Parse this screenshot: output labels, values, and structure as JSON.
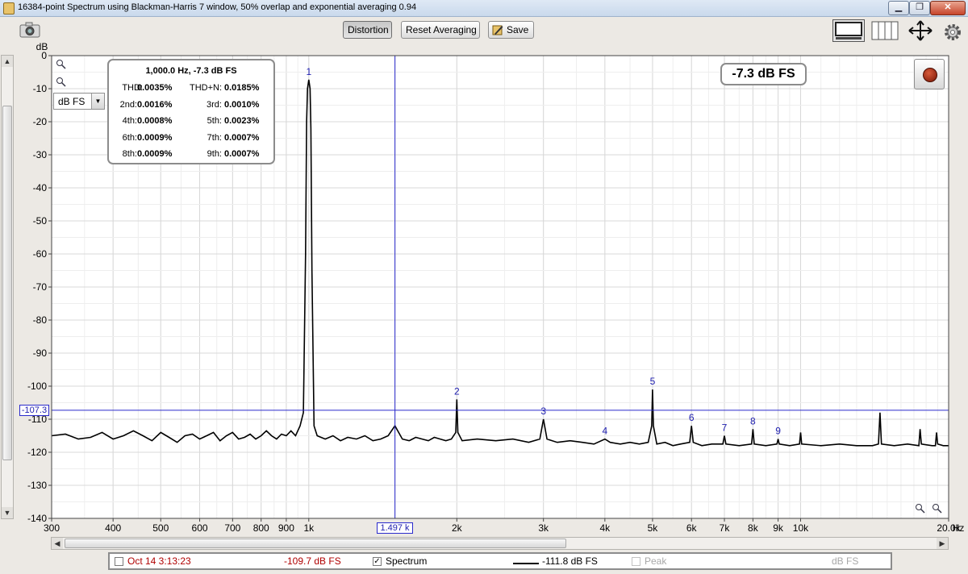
{
  "window": {
    "title": "16384-point Spectrum using Blackman-Harris 7 window, 50% overlap and exponential averaging 0.94",
    "min_label": "▁",
    "restore_label": "❐",
    "close_label": "✕"
  },
  "toolbar": {
    "distortion_label": "Distortion",
    "reset_averaging_label": "Reset Averaging",
    "save_label": "Save"
  },
  "icons": {
    "camera": "camera-icon",
    "save": "pencil-disk-icon",
    "layout": "layout-icon",
    "columns": "columns-icon",
    "pan": "move-arrows-icon",
    "settings": "gear-icon",
    "zoom": "magnifier-icon"
  },
  "plot": {
    "y_unit_label": "dB",
    "units_select_value": "dB FS",
    "x_unit_label": "Hz",
    "level_readout": "-7.3 dB FS",
    "y_cursor_label": "-107.3",
    "x_cursor_label": "1.497 k"
  },
  "distortion": {
    "header": "1,000.0 Hz, -7.3 dB FS",
    "rows": [
      {
        "l1": "THD:",
        "v1": "0.0035%",
        "l2": "THD+N:",
        "v2": "0.0185%"
      },
      {
        "l1": "2nd:",
        "v1": "0.0016%",
        "l2": "3rd:",
        "v2": "0.0010%"
      },
      {
        "l1": "4th:",
        "v1": "0.0008%",
        "l2": "5th:",
        "v2": "0.0023%"
      },
      {
        "l1": "6th:",
        "v1": "0.0009%",
        "l2": "7th:",
        "v2": "0.0007%"
      },
      {
        "l1": "8th:",
        "v1": "0.0009%",
        "l2": "9th:",
        "v2": "0.0007%"
      }
    ]
  },
  "legend": {
    "capture_label": "Oct 14 3:13:23",
    "capture_value": "-109.7 dB FS",
    "spectrum_label": "Spectrum",
    "spectrum_value": "-111.8 dB FS",
    "peak_label": "Peak",
    "peak_value": "dB FS",
    "capture_color": "#b00000",
    "spectrum_checked": "✓"
  },
  "colors": {
    "trace": "#000000",
    "cursor": "#2a2acc",
    "grid": "#d8d8d8",
    "marker_text": "#2020b0"
  },
  "chart_data": {
    "type": "line",
    "x_scale": "log",
    "xlim": [
      300,
      20000
    ],
    "ylim": [
      -140,
      0
    ],
    "xlabel": "Hz",
    "ylabel": "dB",
    "x_ticks": [
      {
        "v": 300,
        "label": "300"
      },
      {
        "v": 400,
        "label": "400"
      },
      {
        "v": 500,
        "label": "500"
      },
      {
        "v": 600,
        "label": "600"
      },
      {
        "v": 700,
        "label": "700"
      },
      {
        "v": 800,
        "label": "800"
      },
      {
        "v": 900,
        "label": "900"
      },
      {
        "v": 1000,
        "label": "1k"
      },
      {
        "v": 2000,
        "label": "2k"
      },
      {
        "v": 3000,
        "label": "3k"
      },
      {
        "v": 4000,
        "label": "4k"
      },
      {
        "v": 5000,
        "label": "5k"
      },
      {
        "v": 6000,
        "label": "6k"
      },
      {
        "v": 7000,
        "label": "7k"
      },
      {
        "v": 8000,
        "label": "8k"
      },
      {
        "v": 9000,
        "label": "9k"
      },
      {
        "v": 10000,
        "label": "10k"
      },
      {
        "v": 20000,
        "label": "20.0k"
      }
    ],
    "y_ticks": [
      {
        "v": 0,
        "label": "0"
      },
      {
        "v": -10,
        "label": "-10"
      },
      {
        "v": -20,
        "label": "-20"
      },
      {
        "v": -30,
        "label": "-30"
      },
      {
        "v": -40,
        "label": "-40"
      },
      {
        "v": -50,
        "label": "-50"
      },
      {
        "v": -60,
        "label": "-60"
      },
      {
        "v": -70,
        "label": "-70"
      },
      {
        "v": -80,
        "label": "-80"
      },
      {
        "v": -90,
        "label": "-90"
      },
      {
        "v": -100,
        "label": "-100"
      },
      {
        "v": -110,
        "label": "-110"
      },
      {
        "v": -120,
        "label": "-120"
      },
      {
        "v": -130,
        "label": "-130"
      },
      {
        "v": -140,
        "label": "-140"
      }
    ],
    "cursor": {
      "x": 1497,
      "y": -107.3
    },
    "harmonics": [
      {
        "label": "1",
        "f": 1000,
        "db": -7.3
      },
      {
        "label": "2",
        "f": 2000,
        "db": -104
      },
      {
        "label": "3",
        "f": 3000,
        "db": -110
      },
      {
        "label": "4",
        "f": 4000,
        "db": -116
      },
      {
        "label": "5",
        "f": 5000,
        "db": -101
      },
      {
        "label": "6",
        "f": 6000,
        "db": -112
      },
      {
        "label": "7",
        "f": 7000,
        "db": -115
      },
      {
        "label": "8",
        "f": 8000,
        "db": -113
      },
      {
        "label": "9",
        "f": 9000,
        "db": -116
      }
    ],
    "series": [
      {
        "values_note": "",
        "points": [
          [
            300,
            -115
          ],
          [
            320,
            -114.5
          ],
          [
            340,
            -116
          ],
          [
            360,
            -115.5
          ],
          [
            380,
            -114
          ],
          [
            400,
            -116
          ],
          [
            420,
            -115
          ],
          [
            440,
            -113.5
          ],
          [
            460,
            -115
          ],
          [
            480,
            -116.5
          ],
          [
            500,
            -114
          ],
          [
            520,
            -115.5
          ],
          [
            540,
            -117
          ],
          [
            560,
            -115
          ],
          [
            580,
            -114.5
          ],
          [
            600,
            -116
          ],
          [
            620,
            -115
          ],
          [
            640,
            -114
          ],
          [
            660,
            -116.5
          ],
          [
            680,
            -115
          ],
          [
            700,
            -114
          ],
          [
            720,
            -116
          ],
          [
            740,
            -115.5
          ],
          [
            760,
            -114.5
          ],
          [
            780,
            -116
          ],
          [
            800,
            -115
          ],
          [
            820,
            -113.5
          ],
          [
            840,
            -115
          ],
          [
            860,
            -116
          ],
          [
            880,
            -114.5
          ],
          [
            900,
            -115
          ],
          [
            920,
            -113.5
          ],
          [
            940,
            -115
          ],
          [
            960,
            -112
          ],
          [
            975,
            -108
          ],
          [
            985,
            -60
          ],
          [
            990,
            -20
          ],
          [
            994,
            -10
          ],
          [
            1000,
            -7.3
          ],
          [
            1006,
            -10
          ],
          [
            1010,
            -22
          ],
          [
            1015,
            -65
          ],
          [
            1025,
            -112
          ],
          [
            1040,
            -115
          ],
          [
            1080,
            -116
          ],
          [
            1120,
            -115
          ],
          [
            1160,
            -116.5
          ],
          [
            1200,
            -115.5
          ],
          [
            1250,
            -116
          ],
          [
            1300,
            -115
          ],
          [
            1350,
            -116.5
          ],
          [
            1400,
            -116
          ],
          [
            1450,
            -115
          ],
          [
            1497,
            -112
          ],
          [
            1550,
            -116
          ],
          [
            1600,
            -116.5
          ],
          [
            1650,
            -115.5
          ],
          [
            1700,
            -116
          ],
          [
            1750,
            -116.5
          ],
          [
            1800,
            -115.5
          ],
          [
            1850,
            -116
          ],
          [
            1900,
            -116.5
          ],
          [
            1950,
            -116
          ],
          [
            1990,
            -114
          ],
          [
            2000,
            -104
          ],
          [
            2010,
            -114
          ],
          [
            2050,
            -116.5
          ],
          [
            2200,
            -116
          ],
          [
            2400,
            -116.5
          ],
          [
            2600,
            -116
          ],
          [
            2800,
            -117
          ],
          [
            2950,
            -116
          ],
          [
            3000,
            -110
          ],
          [
            3050,
            -116
          ],
          [
            3200,
            -117
          ],
          [
            3400,
            -116.5
          ],
          [
            3600,
            -117
          ],
          [
            3800,
            -117.5
          ],
          [
            4000,
            -116
          ],
          [
            4100,
            -117
          ],
          [
            4300,
            -117.5
          ],
          [
            4500,
            -117
          ],
          [
            4700,
            -117.5
          ],
          [
            4900,
            -117
          ],
          [
            4980,
            -112
          ],
          [
            5000,
            -101
          ],
          [
            5020,
            -112
          ],
          [
            5100,
            -117.5
          ],
          [
            5300,
            -117
          ],
          [
            5500,
            -118
          ],
          [
            5700,
            -117.5
          ],
          [
            5950,
            -117
          ],
          [
            6000,
            -112
          ],
          [
            6050,
            -117
          ],
          [
            6300,
            -118
          ],
          [
            6600,
            -117.5
          ],
          [
            6950,
            -117.5
          ],
          [
            7000,
            -115
          ],
          [
            7050,
            -117.5
          ],
          [
            7500,
            -118
          ],
          [
            7950,
            -117.5
          ],
          [
            8000,
            -113
          ],
          [
            8050,
            -117.5
          ],
          [
            8500,
            -118
          ],
          [
            8950,
            -117.5
          ],
          [
            9000,
            -116
          ],
          [
            9050,
            -117.5
          ],
          [
            9500,
            -118
          ],
          [
            9950,
            -117.5
          ],
          [
            10000,
            -114
          ],
          [
            10050,
            -117.5
          ],
          [
            11000,
            -118
          ],
          [
            12000,
            -117.5
          ],
          [
            13000,
            -118
          ],
          [
            14000,
            -118
          ],
          [
            14400,
            -117.5
          ],
          [
            14500,
            -108
          ],
          [
            14600,
            -117.5
          ],
          [
            15500,
            -118
          ],
          [
            16500,
            -117.5
          ],
          [
            17400,
            -118
          ],
          [
            17500,
            -113
          ],
          [
            17600,
            -117.5
          ],
          [
            18500,
            -118
          ],
          [
            18800,
            -118
          ],
          [
            18900,
            -114
          ],
          [
            19000,
            -117.5
          ],
          [
            19500,
            -118
          ],
          [
            20000,
            -118
          ]
        ]
      }
    ]
  }
}
